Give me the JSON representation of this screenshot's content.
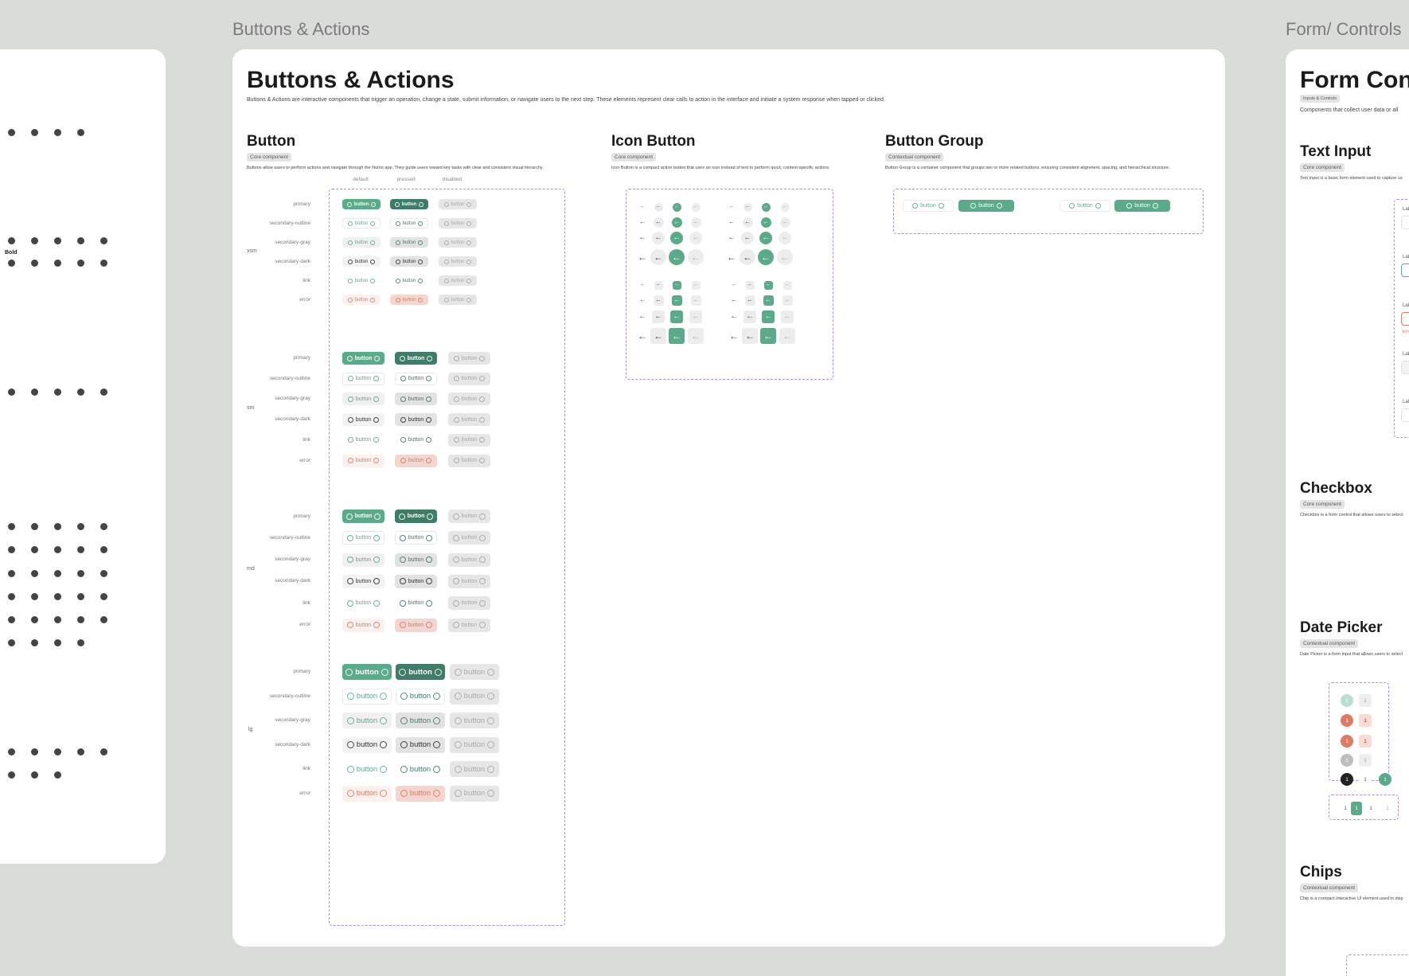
{
  "frames": {
    "buttons_title": "Buttons & Actions",
    "forms_title": "Form/ Controls"
  },
  "left": {
    "bold_label": "Bold"
  },
  "buttons": {
    "title": "Buttons & Actions",
    "description": "Buttons & Actions are interactive components that trigger an operation, change a state, submit information, or navigate users to the next step. These elements represent clear calls to action in the interface and initiate a system response when tapped or clicked.",
    "button_section": {
      "title": "Button",
      "tag": "Core component",
      "description": "Buttons allow users to perform actions and navigate through the Nutrio app. They guide users toward key tasks with clear and consistent visual hierarchy."
    },
    "icon_section": {
      "title": "Icon Button",
      "tag": "Core component",
      "description": "Icon Button is a compact action button that uses an icon instead of text to perform quick, context-specific actions."
    },
    "group_section": {
      "title": "Button Group",
      "tag": "Contextual component",
      "description": "Button Group is a container component that groups two or more related buttons, ensuring consistent alignment, spacing, and hierarchical structure."
    },
    "columns": [
      "default",
      "pressed",
      "disabled"
    ],
    "sizes": [
      "xsm",
      "sm",
      "md",
      "lg"
    ],
    "variants": [
      "primary",
      "secondary-outline",
      "secondary-gray",
      "secondary-dark",
      "link",
      "error"
    ],
    "button_label": "button",
    "arrow_glyph": "←",
    "group_buttons": [
      "button",
      "button",
      "button",
      "button"
    ]
  },
  "forms": {
    "title": "Form Cont",
    "tag": "Inputs & Controls",
    "description": "Components that collect user data or all",
    "text_input": {
      "title": "Text Input",
      "tag": "Core component",
      "description": "Text Input is a basic form element used to capture us"
    },
    "checkbox": {
      "title": "Checkbox",
      "tag": "Core component",
      "description": "Checkbox is a form control that allows users to select"
    },
    "date_picker": {
      "title": "Date Picker",
      "tag": "Contextual component",
      "description": "Date Picker is a form input that allows users to select"
    },
    "chips": {
      "title": "Chips",
      "tag": "Contextual component",
      "description": "Chip is a compact interactive UI element used to disp"
    },
    "input_labels": [
      "Lab",
      "Lab",
      "Lab",
      "Lab",
      "Lab"
    ],
    "error_text": "Erro",
    "day": "1"
  },
  "colors": {
    "primary": "#5aab8a",
    "pressed": "#3f7e66",
    "error": "#e07a63",
    "dashed": "#a78bfa"
  }
}
